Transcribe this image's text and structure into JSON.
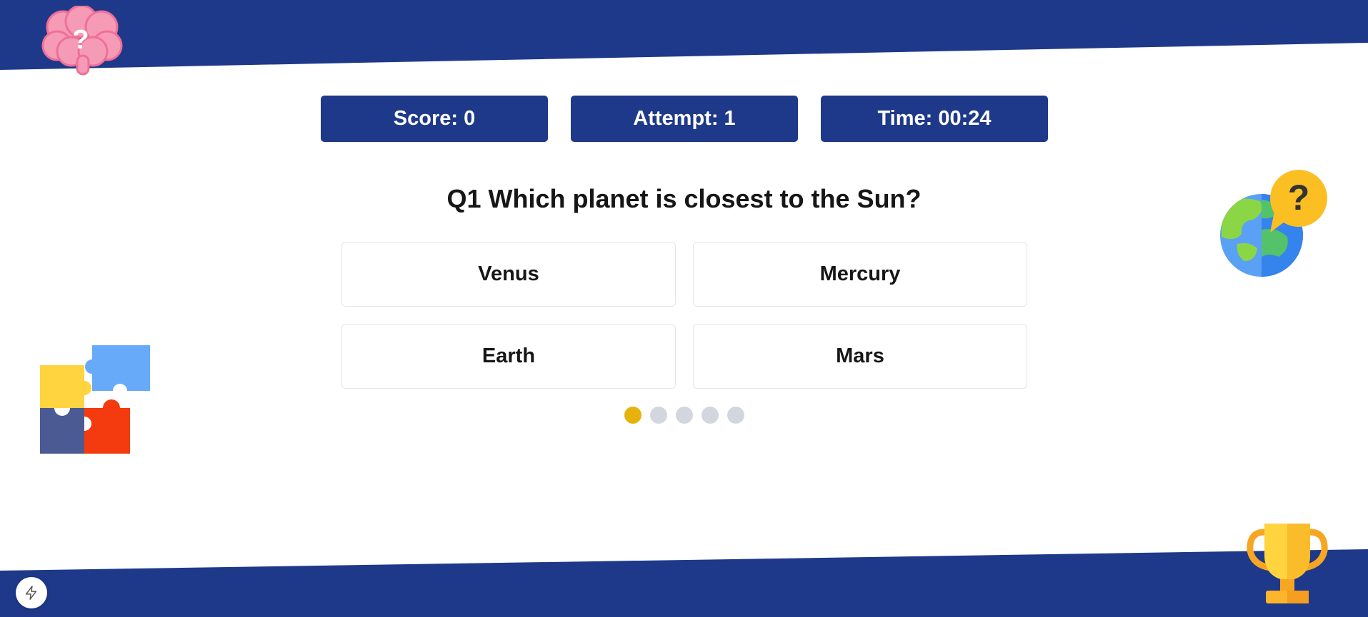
{
  "stats": {
    "score_label": "Score: 0",
    "attempt_label": "Attempt: 1",
    "time_label": "Time: 00:24"
  },
  "question": {
    "text": "Q1 Which planet is closest to the Sun?"
  },
  "options": [
    {
      "label": "Venus"
    },
    {
      "label": "Mercury"
    },
    {
      "label": "Earth"
    },
    {
      "label": "Mars"
    }
  ],
  "progress": {
    "total": 5,
    "current": 1
  },
  "decorations": {
    "brain_icon": "brain-question-icon",
    "globe_icon": "globe-question-icon",
    "puzzle_icon": "puzzle-icon",
    "trophy_icon": "trophy-icon"
  },
  "colors": {
    "primary": "#1e398a",
    "active_dot": "#e8b20c",
    "inactive_dot": "#d3d6de",
    "text": "#161616"
  }
}
